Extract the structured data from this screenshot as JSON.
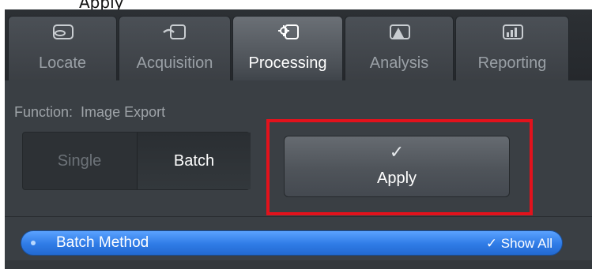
{
  "caption": {
    "text": "Apply"
  },
  "tabs": [
    {
      "label": "Locate",
      "icon": "locate-icon",
      "active": false
    },
    {
      "label": "Acquisition",
      "icon": "acquisition-icon",
      "active": false
    },
    {
      "label": "Processing",
      "icon": "processing-gear-icon",
      "active": true
    },
    {
      "label": "Analysis",
      "icon": "analysis-peak-icon",
      "active": false
    },
    {
      "label": "Reporting",
      "icon": "reporting-bar-icon",
      "active": false
    }
  ],
  "function": {
    "prefix": "Function:",
    "value": "Image Export"
  },
  "mode": {
    "single_label": "Single",
    "batch_label": "Batch",
    "selected": "Batch"
  },
  "apply": {
    "check_glyph": "✓",
    "label": "Apply"
  },
  "section": {
    "title": "Batch Method",
    "show_all": "✓ Show All"
  },
  "colors": {
    "highlight": "#e2121c",
    "accent": "#2f7be6",
    "panel": "#3a3f44"
  }
}
